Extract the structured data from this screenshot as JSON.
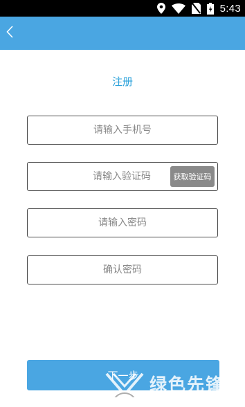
{
  "status_bar": {
    "time": "5:43",
    "icons": [
      "location-icon",
      "wifi-icon",
      "no-sim-icon",
      "battery-icon"
    ]
  },
  "app_bar": {
    "back_icon": "chevron-left-icon",
    "color": "#4aa6e2"
  },
  "page": {
    "title": "注册"
  },
  "form": {
    "phone_placeholder": "请输入手机号",
    "code_placeholder": "请输入验证码",
    "get_code_label": "获取验证码",
    "password_placeholder": "请输入密码",
    "confirm_placeholder": "确认密码"
  },
  "next_button": {
    "label": "下一步"
  },
  "watermark": {
    "text": "绿色先锋"
  },
  "colors": {
    "accent": "#4aa6e2",
    "title": "#2aa1da",
    "code_button": "#8a8a8a"
  }
}
